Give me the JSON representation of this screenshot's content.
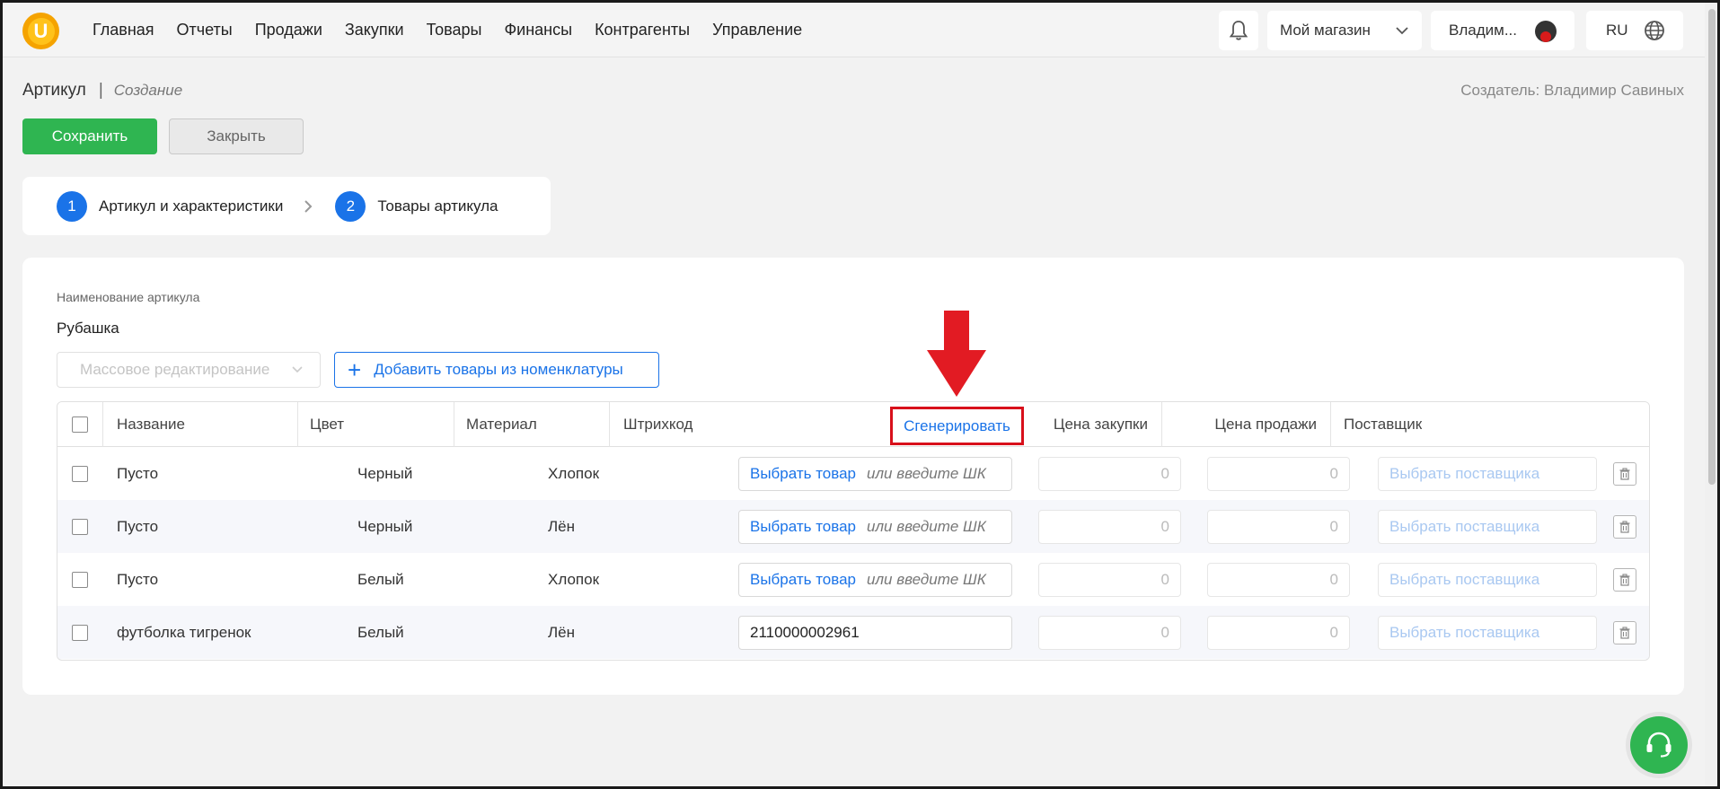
{
  "nav": {
    "logo_letter": "U",
    "items": [
      "Главная",
      "Отчеты",
      "Продажи",
      "Закупки",
      "Товары",
      "Финансы",
      "Контрагенты",
      "Управление"
    ],
    "store": "Мой магазин",
    "user": "Владим...",
    "lang": "RU"
  },
  "header": {
    "title": "Артикул",
    "separator": "|",
    "mode": "Создание",
    "creator": "Создатель: Владимир Савиных"
  },
  "actions": {
    "save": "Сохранить",
    "close": "Закрыть"
  },
  "steps": [
    {
      "num": "1",
      "label": "Артикул и характеристики"
    },
    {
      "num": "2",
      "label": "Товары артикула"
    }
  ],
  "form": {
    "name_caption": "Наименование артикула",
    "name_value": "Рубашка",
    "bulk_edit": "Массовое редактирование",
    "add_button": "Добавить товары из номенклатуры"
  },
  "table": {
    "headers": {
      "name": "Название",
      "color": "Цвет",
      "material": "Материал",
      "barcode": "Штрихкод",
      "generate": "Сгенерировать",
      "purchase": "Цена закупки",
      "sale": "Цена продажи",
      "supplier": "Поставщик"
    },
    "pick_product": "Выбрать товар",
    "barcode_hint": "или введите ШК",
    "supplier_placeholder": "Выбрать поставщика",
    "rows": [
      {
        "name": "Пусто",
        "color": "Черный",
        "material": "Хлопок",
        "barcode": "",
        "purchase": "0",
        "sale": "0"
      },
      {
        "name": "Пусто",
        "color": "Черный",
        "material": "Лён",
        "barcode": "",
        "purchase": "0",
        "sale": "0"
      },
      {
        "name": "Пусто",
        "color": "Белый",
        "material": "Хлопок",
        "barcode": "",
        "purchase": "0",
        "sale": "0"
      },
      {
        "name": "футболка тигренок",
        "color": "Белый",
        "material": "Лён",
        "barcode": "2110000002961",
        "purchase": "0",
        "sale": "0"
      }
    ]
  },
  "colors": {
    "accent": "#1a73e8",
    "save": "#2fb551",
    "highlight": "#d8101b"
  }
}
